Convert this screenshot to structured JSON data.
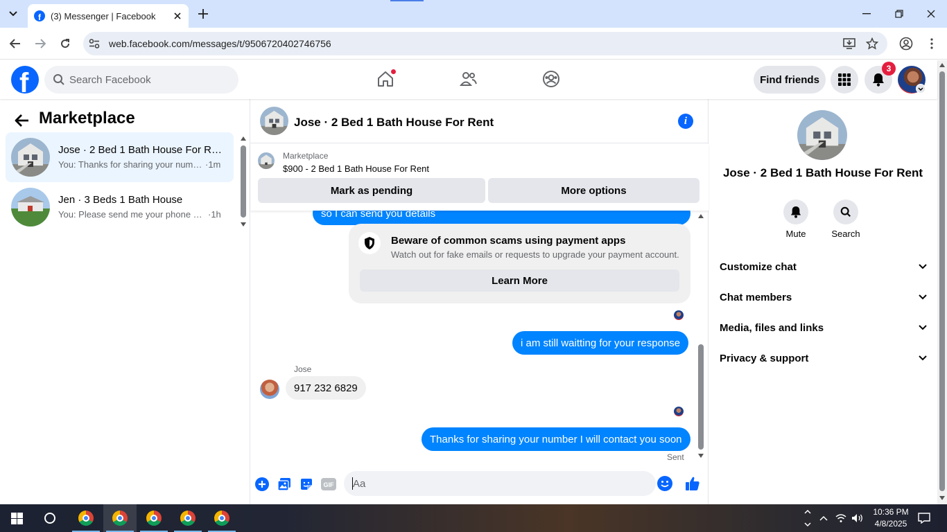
{
  "browser": {
    "tab_title": "(3) Messenger | Facebook",
    "url": "web.facebook.com/messages/t/9506720402746756"
  },
  "fb_header": {
    "search_placeholder": "Search Facebook",
    "find_friends_label": "Find friends",
    "notification_count": "3"
  },
  "sidebar": {
    "title": "Marketplace",
    "conversations": [
      {
        "name": "Jose · 2 Bed 1 Bath House For Re...",
        "preview": "You: Thanks for sharing your numb...",
        "time": "·1m",
        "active": true
      },
      {
        "name": "Jen · 3 Beds 1 Bath House",
        "preview": "You: Please send me your phone n...",
        "time": "·1h",
        "active": false
      }
    ]
  },
  "chat": {
    "title": "Jose · 2 Bed 1 Bath House For Rent",
    "listing": {
      "source": "Marketplace",
      "description": "$900 - 2 Bed 1 Bath House For Rent",
      "pending_button": "Mark as pending",
      "options_button": "More options"
    },
    "messages": {
      "partial_out": "so I can send you  details",
      "scam_title": "Beware of common scams using payment apps",
      "scam_body": "Watch out for fake emails or requests to upgrade your payment account.",
      "learn_more": "Learn More",
      "out_1": "i am still waitting for your response",
      "sender_name": "Jose",
      "in_1": "917 232 6829",
      "out_2": "Thanks for sharing your number I will contact you soon",
      "status": "Sent"
    },
    "composer_placeholder": "Aa"
  },
  "right_panel": {
    "name": "Jose · 2 Bed 1 Bath House For Rent",
    "actions": {
      "mute": "Mute",
      "search": "Search"
    },
    "sections": [
      "Customize chat",
      "Chat members",
      "Media, files and links",
      "Privacy & support"
    ]
  },
  "taskbar": {
    "time": "10:36 PM",
    "date": "4/8/2025"
  },
  "colors": {
    "fb_blue": "#0866ff",
    "messenger_blue": "#0084ff",
    "active_conversation_bg": "#ebf5ff",
    "notification_red": "#e41e3f"
  }
}
